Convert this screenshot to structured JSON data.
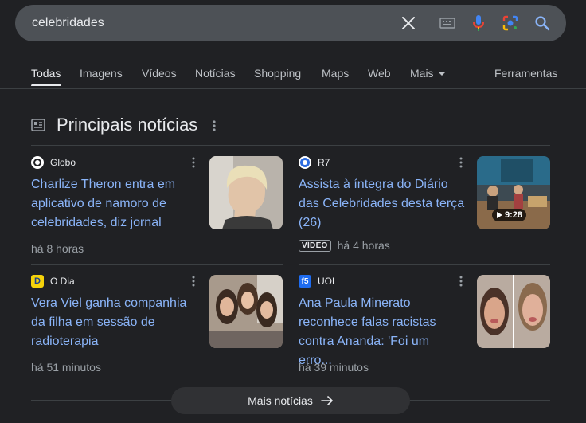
{
  "search": {
    "query": "celebridades",
    "icons": [
      "close-icon",
      "keyboard-icon",
      "mic-icon",
      "lens-icon",
      "search-icon"
    ]
  },
  "tabs": [
    {
      "label": "Todas",
      "active": true
    },
    {
      "label": "Imagens"
    },
    {
      "label": "Vídeos"
    },
    {
      "label": "Notícias"
    },
    {
      "label": "Shopping"
    },
    {
      "label": "Maps"
    },
    {
      "label": "Web"
    },
    {
      "label": "Mais"
    }
  ],
  "tools_label": "Ferramentas",
  "section": {
    "title": "Principais notícias"
  },
  "news": [
    {
      "source": "Globo",
      "logo_text": "G",
      "logo_color": "#ffffff",
      "headline": "Charlize Theron entra em aplicativo de namoro de celebridades, diz jornal",
      "time": "há 8 horas",
      "thumb_icon": "portrait-photo"
    },
    {
      "source": "R7",
      "logo_text": "R",
      "logo_color": "#2d6cdf",
      "headline": "Assista à íntegra do Diário das Celebridades desta terça (26)",
      "badge": "VÍDEO",
      "time": "há 4 horas",
      "duration": "9:28",
      "thumb_icon": "tv-studio-photo"
    },
    {
      "source": "O Dia",
      "logo_text": "D",
      "logo_color": "#f5d20a",
      "headline": "Vera Viel ganha companhia da filha em sessão de radioterapia",
      "time": "há 51 minutos",
      "thumb_icon": "group-selfie-photo"
    },
    {
      "source": "UOL",
      "logo_text": "f5",
      "logo_color": "#1e6cf0",
      "headline": "Ana Paula Minerato reconhece falas racistas contra Ananda: 'Foi um erro...",
      "time": "há 39 minutos",
      "thumb_icon": "crying-faces-photo"
    }
  ],
  "more_button": {
    "label": "Mais notícias"
  },
  "colors": {
    "link": "#8ab4f8",
    "background": "#202124",
    "searchbar": "#4d5156"
  }
}
